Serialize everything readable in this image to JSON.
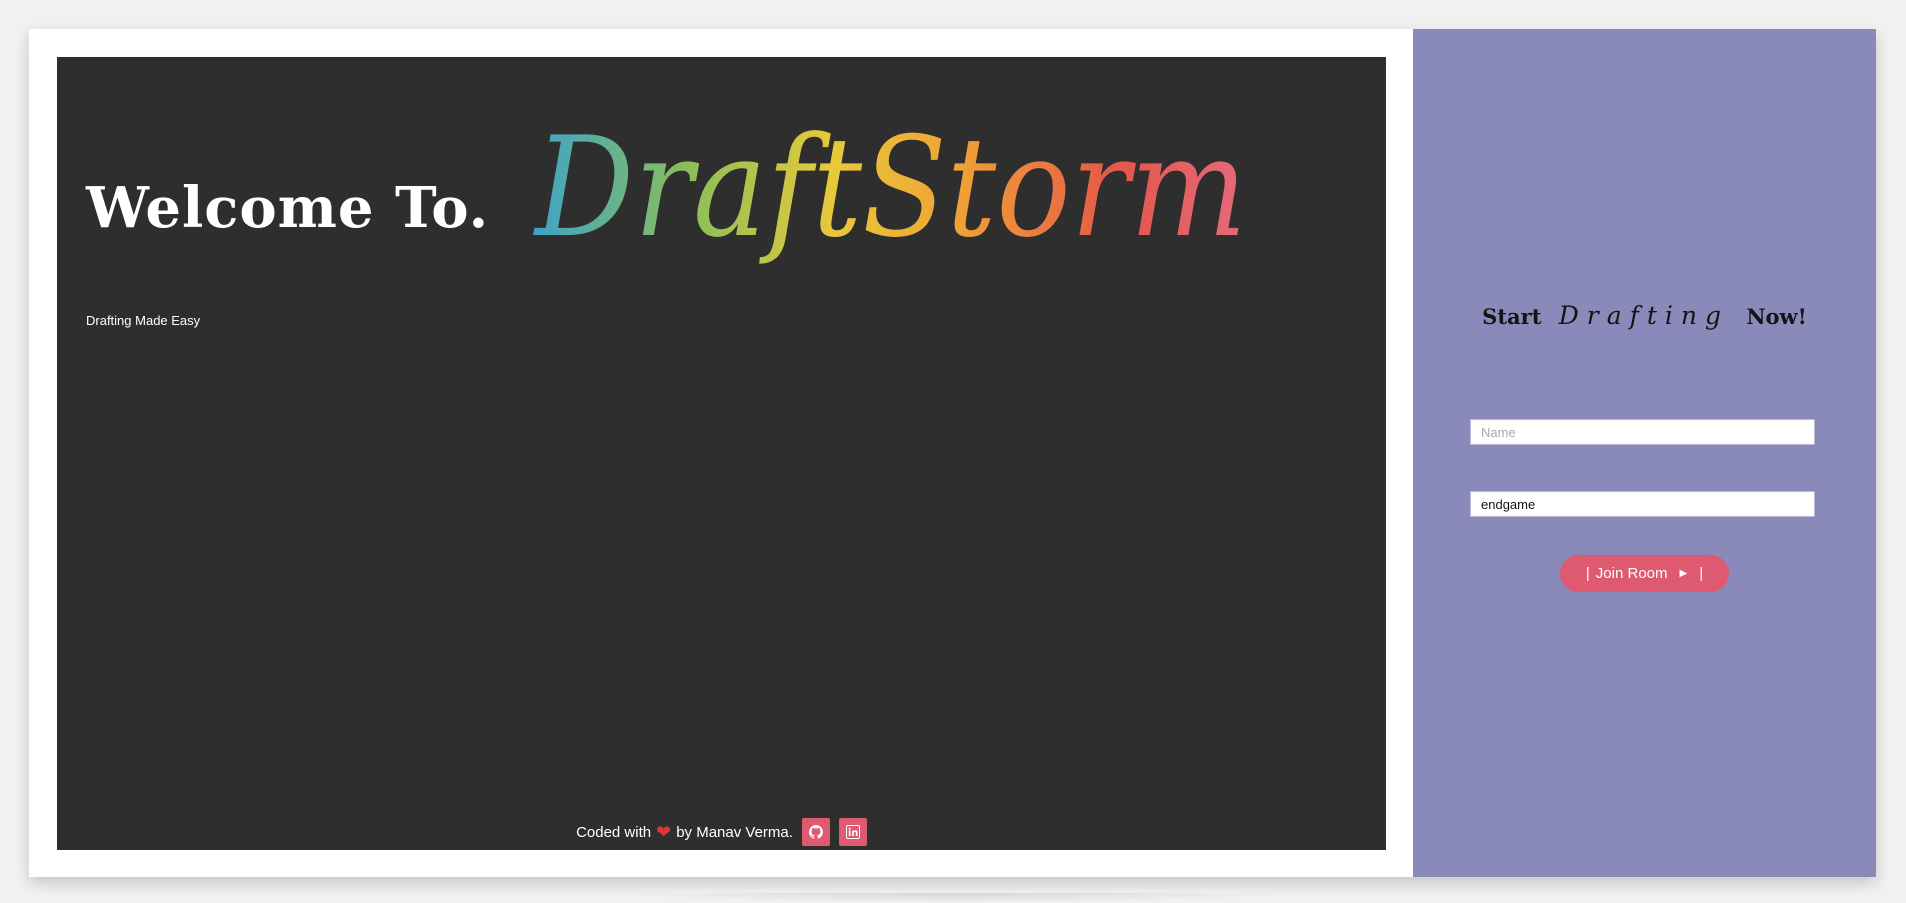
{
  "hero": {
    "welcome_text": "Welcome To.",
    "brand_name": "DraftStorm",
    "tagline": "Drafting Made Easy",
    "credit_prefix": "Coded with",
    "credit_suffix": "by Manav Verma.",
    "heart_icon": "heart-icon",
    "social_links": [
      {
        "icon": "github-icon"
      },
      {
        "icon": "linkedin-icon"
      }
    ]
  },
  "sidebar": {
    "start_word": "Start",
    "drafting_word": "Drafting",
    "now_word": "Now!",
    "name_placeholder": "Name",
    "name_value": "",
    "room_value": "endgame",
    "join_label": "Join Room",
    "join_prefix": "|",
    "join_suffix": "|",
    "join_icon": "play-triangle-icon"
  },
  "colors": {
    "hero_bg": "#2e2e2e",
    "sidebar_bg": "#8a8aba",
    "accent": "#dd5a71",
    "brand_gradient": [
      "#3fa3c7",
      "#8bbf5a",
      "#e8c93a",
      "#f0a036",
      "#e4574a",
      "#e56a7c"
    ]
  }
}
